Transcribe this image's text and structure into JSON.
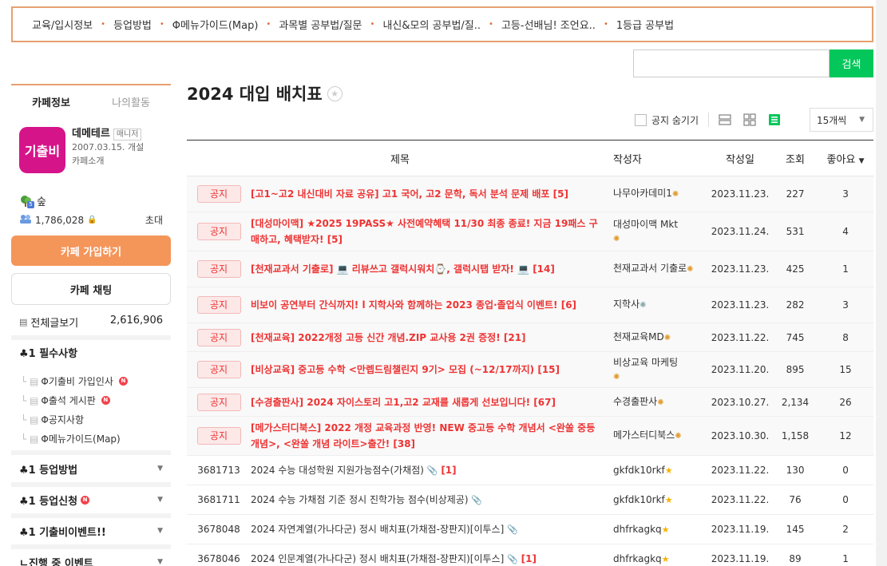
{
  "topnav": [
    "교육/입시정보",
    "등업방법",
    "Φ메뉴가이드(Map)",
    "과목별 공부법/질문",
    "내신&모의 공부법/질..",
    "고등-선배님! 조언요..",
    "1등급 공부법"
  ],
  "search": {
    "button": "검색",
    "placeholder": ""
  },
  "sidebar": {
    "tab_info": "카페정보",
    "tab_activity": "나의활동",
    "logo_text": "기출비",
    "cafe_name": "데메테르",
    "manager_badge": "매니저",
    "founded": "2007.03.15. 개설",
    "intro": "카페소개",
    "rank": "숲",
    "rank_badge": "5",
    "members": "1,786,028",
    "invite": "초대",
    "join": "카페 가입하기",
    "chat": "카페 채팅",
    "all_posts_label": "전체글보기",
    "all_posts_count": "2,616,906",
    "menu1": "♣1 필수사항",
    "sub_items": [
      "Φ기출비 가입인사",
      "Φ출석 게시판",
      "Φ공지사항",
      "Φ메뉴가이드(Map)"
    ],
    "menu2": "♣1 등업방법",
    "menu3": "♣1 등업신청",
    "menu4": "♣1 기출비이벤트!!",
    "menu5": "ㄴ진행 중 이벤트",
    "new_badge": "N"
  },
  "main": {
    "title": "2024 대입 배치표",
    "notice_hide": "공지 숨기기",
    "per_page": "15개씩"
  },
  "table": {
    "headers": {
      "title": "제목",
      "author": "작성자",
      "date": "작성일",
      "views": "조회",
      "likes": "좋아요"
    },
    "notice_label": "공지",
    "notices": [
      {
        "title": "[고1~고2 내신대비 자료 공유] 고1 국어, 고2 문학, 독서 분석 문제 배포",
        "comments": "[5]",
        "author": "나무아카데미1",
        "date": "2023.11.23.",
        "views": "227",
        "likes": "3"
      },
      {
        "title": "[대성마이맥] ★2025 19PASS★ 사전예약혜택 11/30 최종 종료! 지금 19패스 구매하고, 혜택받자!",
        "comments": "[5]",
        "author": "대성마이맥 Mkt",
        "date": "2023.11.24.",
        "views": "531",
        "likes": "4"
      },
      {
        "title": "[천재교과서 기출로] 💻 리뷰쓰고 갤럭시워치⌚, 갤럭시탭 받자! 💻",
        "comments": "[14]",
        "author": "천재교과서 기출로",
        "date": "2023.11.23.",
        "views": "425",
        "likes": "1"
      },
      {
        "title": "비보이 공연부터 간식까지! l 지학사와 함께하는 2023 종업·졸업식 이벤트!",
        "comments": "[6]",
        "author": "지학사",
        "date": "2023.11.23.",
        "views": "282",
        "likes": "3"
      },
      {
        "title": "[천재교육] 2022개정 고등 신간 개념.ZIP 교사용 2권 증정!",
        "comments": "[21]",
        "author": "천재교육MD",
        "date": "2023.11.22.",
        "views": "745",
        "likes": "8"
      },
      {
        "title": "[비상교육] 중고등 수학 <만렙드림챌린지 9기> 모집 (~12/17까지)",
        "comments": "[15]",
        "author": "비상교육 마케팅",
        "date": "2023.11.20.",
        "views": "895",
        "likes": "15"
      },
      {
        "title": "[수경출판사] 2024 자이스토리 고1,고2 교재를 새롭게 선보입니다!",
        "comments": "[67]",
        "author": "수경출판사",
        "date": "2023.10.27.",
        "views": "2,134",
        "likes": "26"
      },
      {
        "title": "[메가스터디북스] 2022 개정 교육과정 반영! NEW 중고등 수학 개념서 <완쏠 중등 개념>, <완쏠 개념 라이트>출간!",
        "comments": "[38]",
        "author": "메가스터디북스",
        "date": "2023.10.30.",
        "views": "1,158",
        "likes": "12"
      }
    ],
    "posts": [
      {
        "num": "3681713",
        "title": "2024 수능 대성학원 지원가능점수(가채점)",
        "comments": "[1]",
        "author": "gkfdk10rkf",
        "date": "2023.11.22.",
        "views": "130",
        "likes": "0"
      },
      {
        "num": "3681711",
        "title": "2024 수능 가채점 기준 정시 진학가능 점수(비상제공)",
        "comments": "",
        "author": "gkfdk10rkf",
        "date": "2023.11.22.",
        "views": "76",
        "likes": "0"
      },
      {
        "num": "3678048",
        "title": "2024 자연계열(가나다군) 정시 배치표(가채점-장판지)[이투스]",
        "comments": "",
        "author": "dhfrkagkq",
        "date": "2023.11.19.",
        "views": "145",
        "likes": "2"
      },
      {
        "num": "3678046",
        "title": "2024 인문계열(가나다군) 정시 배치표(가채점-장판지)[이투스]",
        "comments": "[1]",
        "author": "dhfrkagkq",
        "date": "2023.11.19.",
        "views": "89",
        "likes": "1"
      }
    ]
  },
  "colors": {
    "accent": "#03c75a",
    "border": "#e6a070",
    "join": "#f4955a",
    "notice": "#e33"
  }
}
